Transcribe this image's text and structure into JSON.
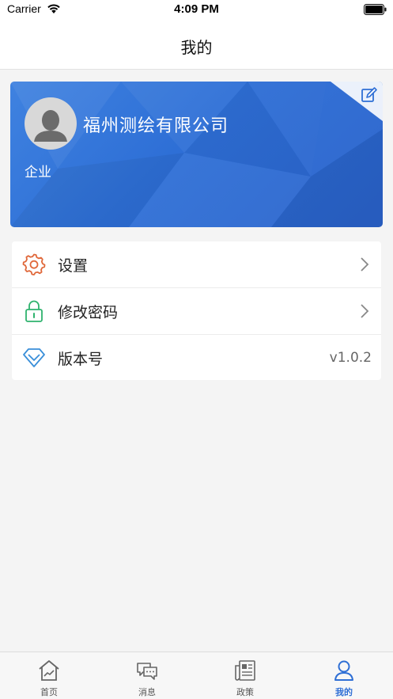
{
  "status_bar": {
    "carrier": "Carrier",
    "time": "4:09 PM"
  },
  "nav": {
    "title": "我的"
  },
  "profile": {
    "company_name": "福州测绘有限公司",
    "account_type": "企业"
  },
  "menu": [
    {
      "label": "设置",
      "icon": "gear-icon",
      "color": "#e0683a"
    },
    {
      "label": "修改密码",
      "icon": "lock-icon",
      "color": "#2fb36e"
    },
    {
      "label": "版本号",
      "icon": "diamond-icon",
      "color": "#3a8fd9",
      "value": "v1.0.2"
    }
  ],
  "tabs": [
    {
      "label": "首页",
      "icon": "home-chart-icon"
    },
    {
      "label": "消息",
      "icon": "chat-bubbles-icon"
    },
    {
      "label": "政策",
      "icon": "newspaper-icon"
    },
    {
      "label": "我的",
      "icon": "user-profile-icon",
      "active": true
    }
  ],
  "colors": {
    "accent": "#2f6fd5",
    "card": "#3275db"
  }
}
